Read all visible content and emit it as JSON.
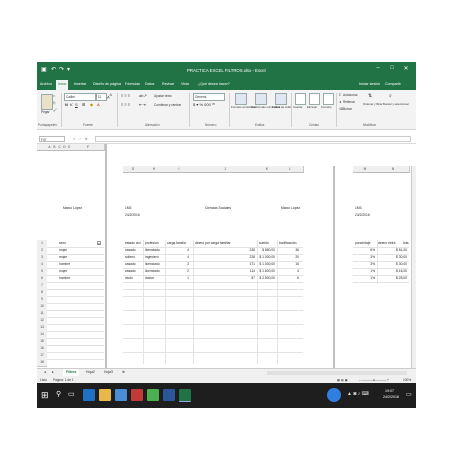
{
  "titlebar": {
    "title": "PRACTICA EXCEL FILTROS.xlsx - Excel"
  },
  "tabs": [
    "Archivo",
    "Inicio",
    "Insertar",
    "Diseño de página",
    "Fórmulas",
    "Datos",
    "Revisar",
    "Vista",
    "¿Qué desea hacer?"
  ],
  "tabs_right": {
    "signin": "Iniciar sesión",
    "share": "Compartir"
  },
  "ribbon": {
    "paste": "Pegar",
    "font_name": "Calibri",
    "font_size": "11",
    "wrap": "Ajustar texto",
    "merge": "Combinar y centrar",
    "number_format": "General",
    "cond_format": "Formato condicional",
    "format_table": "Dar formato como tabla",
    "cell_styles": "Estilos de celda",
    "insert": "Insertar",
    "delete": "Eliminar",
    "format": "Formato",
    "autosum": "Autosuma",
    "fill": "Rellenar",
    "clear": "Borrar",
    "sort_filter": "Ordenar y filtrar",
    "find_select": "Buscar y seleccionar",
    "groups": [
      "Portapapeles",
      "Fuente",
      "Alineación",
      "Número",
      "Estilos",
      "Celdas",
      "Modificar"
    ]
  },
  "formula_bar": {
    "name_box": "F47",
    "fx": "fx",
    "value": ""
  },
  "columns_left": [
    "A",
    "B",
    "C",
    "D",
    "E",
    "F"
  ],
  "columns_mid": [
    "G",
    "H",
    "I",
    "J",
    "K",
    "L"
  ],
  "columns_right": [
    "M",
    "N"
  ],
  "rows": [
    "1",
    "2",
    "3",
    "4",
    "5",
    "6",
    "7",
    "8",
    "9",
    "10",
    "11",
    "12",
    "13",
    "14",
    "15",
    "16",
    "17",
    "18"
  ],
  "left_panel": {
    "name": "Marco López",
    "header": "sexo",
    "values": [
      "mujer",
      "mujer",
      "hombre",
      "mujer",
      "hombre"
    ]
  },
  "mid_panel": {
    "code": "1M3",
    "date": "24/2/2016",
    "title": "Ciencias Sociales",
    "name": "Marco López",
    "headers": [
      "estado civi",
      "profesion",
      "carga familia",
      "dinero por carga familiar",
      "sueldo",
      "bonificación"
    ],
    "rows": [
      [
        "casado",
        "licenciado",
        "4",
        "228",
        "$ 850,00",
        "36"
      ],
      [
        "soltero",
        "ingeniero",
        "4",
        "228",
        "$ 1.000,00",
        "20"
      ],
      [
        "casado",
        "licenciado",
        "3",
        "171",
        "$ 1.000,00",
        "16"
      ],
      [
        "casado",
        "licenciado",
        "2",
        "114",
        "$ 1.600,00",
        "4"
      ],
      [
        "viudo",
        "doctor",
        "1",
        "57",
        "$ 2.500,00",
        "6"
      ]
    ]
  },
  "right_panel": {
    "code": "1M3",
    "date": "24/2/2016",
    "headers": [
      "porcentaje",
      "dinero extra",
      "tota"
    ],
    "rows": [
      [
        "6%",
        "$ 51,00"
      ],
      [
        "3%",
        "$ 30,00"
      ],
      [
        "3%",
        "$ 30,00"
      ],
      [
        "1%",
        "$ 16,00"
      ],
      [
        "1%",
        "$ 25,00"
      ]
    ]
  },
  "sheet_tabs": [
    "Filtros",
    "Hoja2",
    "Hoja3"
  ],
  "status": {
    "left": "Listo",
    "page": "Página: 1 de 1",
    "zoom": "100%"
  },
  "taskbar": {
    "time": "19:07",
    "date": "24/2/2016"
  }
}
